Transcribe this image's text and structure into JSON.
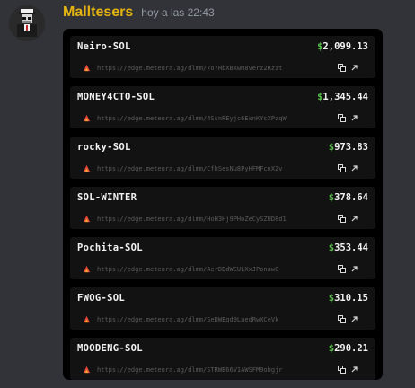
{
  "message": {
    "username": "Malltesers",
    "timestamp": "hoy a las 22:43",
    "username_color": "#e5b20f"
  },
  "pools": [
    {
      "name": "Neiro-SOL",
      "value": "2,099.13",
      "url": "https://edge.meteora.ag/dlmm/7o7HbXBkwm8verz2Rzzt"
    },
    {
      "name": "MONEY4CTO-SOL",
      "value": "1,345.44",
      "url": "https://edge.meteora.ag/dlmm/4SsnREyjc6EsnKYsXPzqW"
    },
    {
      "name": "rocky-SOL",
      "value": "973.83",
      "url": "https://edge.meteora.ag/dlmm/CfhSesNu8PyHFMFcnXZv"
    },
    {
      "name": "SOL-WINTER",
      "value": "378.64",
      "url": "https://edge.meteora.ag/dlmm/HoH3Hj9PHoZeCySZUD8d1"
    },
    {
      "name": "Pochita-SOL",
      "value": "353.44",
      "url": "https://edge.meteora.ag/dlmm/AerDDdWCULXxJPonawC"
    },
    {
      "name": "FWOG-SOL",
      "value": "310.15",
      "url": "https://edge.meteora.ag/dlmm/SeDWEqd9LuedRwXCeVk"
    },
    {
      "name": "MOODENG-SOL",
      "value": "290.21",
      "url": "https://edge.meteora.ag/dlmm/STRWB66V1AWSFM9obgjr"
    }
  ],
  "currency_symbol": "$",
  "colors": {
    "accent": "#e5b20f",
    "dollar": "#57c24a",
    "panel": "#000000",
    "favicon": "#e8483c"
  },
  "icons": {
    "copy": "copy-icon",
    "open": "external-link-icon",
    "favicon": "meteora-favicon-icon"
  }
}
